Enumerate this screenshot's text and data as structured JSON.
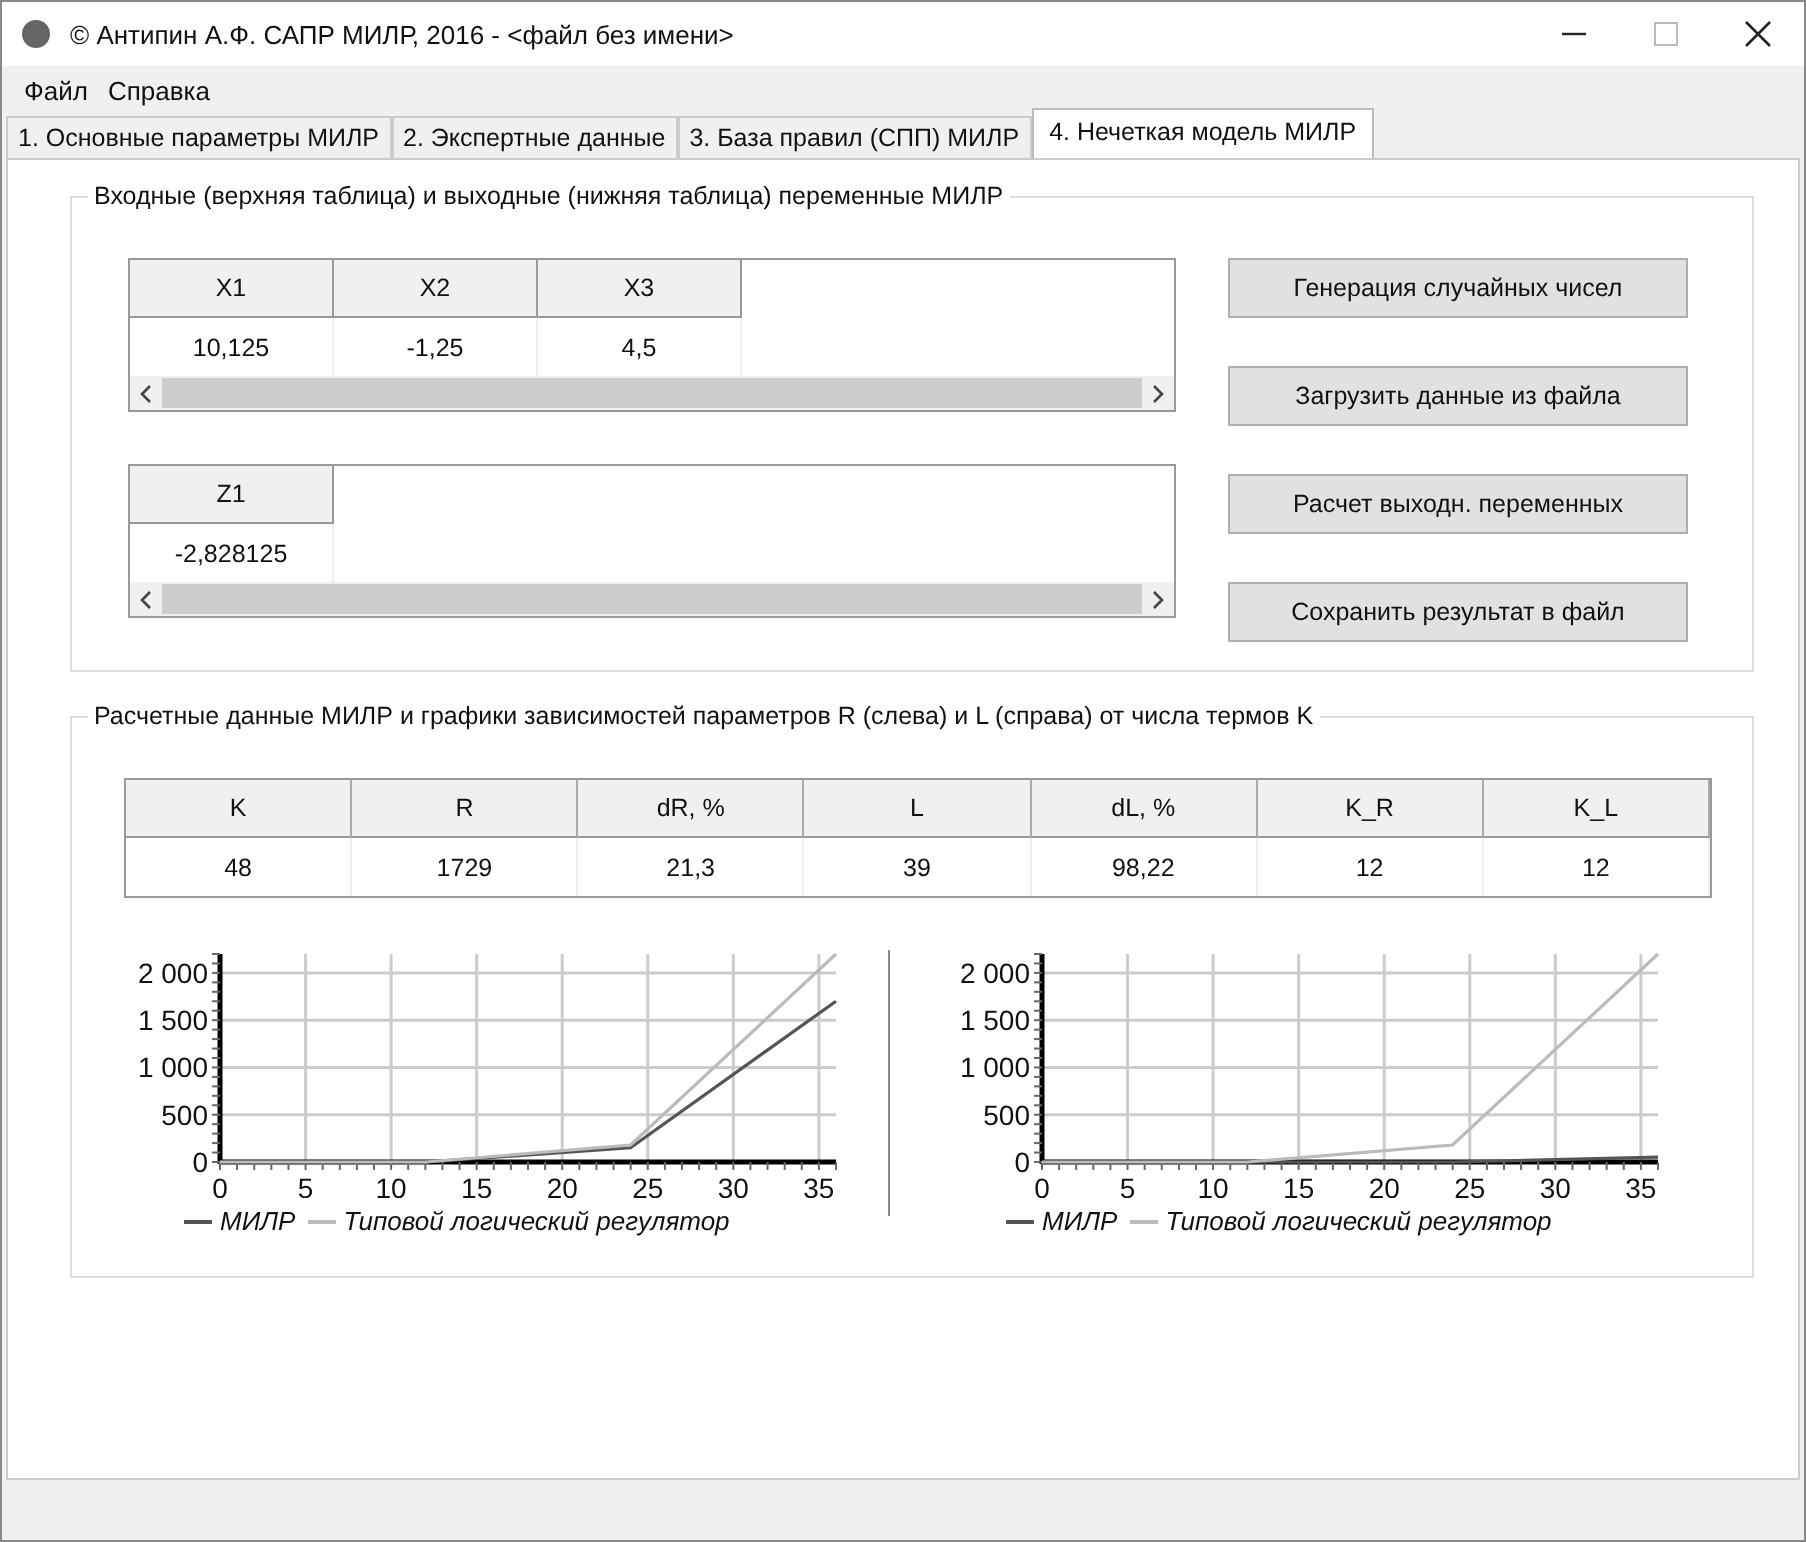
{
  "window": {
    "title": "© Антипин А.Ф. САПР МИЛР, 2016 - <файл без имени>"
  },
  "menu": [
    "Файл",
    "Справка"
  ],
  "tabs": [
    {
      "label": "1. Основные параметры МИЛР",
      "selected": false
    },
    {
      "label": "2. Экспертные данные",
      "selected": false
    },
    {
      "label": "3. База правил (СПП) МИЛР",
      "selected": false
    },
    {
      "label": "4. Нечеткая модель МИЛР",
      "selected": true
    }
  ],
  "variables_group": {
    "title": "Входные (верхняя таблица) и выходные (нижняя таблица) переменные МИЛР",
    "input_table": {
      "columns": [
        "X1",
        "X2",
        "X3"
      ],
      "rows": [
        [
          "10,125",
          "-1,25",
          "4,5"
        ]
      ]
    },
    "output_table": {
      "columns": [
        "Z1"
      ],
      "rows": [
        [
          "-2,828125"
        ]
      ]
    },
    "buttons": [
      "Генерация случайных чисел",
      "Загрузить данные из файла",
      "Расчет выходн. переменных",
      "Сохранить результат в файл"
    ]
  },
  "results_group": {
    "title": "Расчетные данные МИЛР и графики зависимостей параметров R (слева) и L (справа) от числа термов K",
    "table": {
      "columns": [
        "K",
        "R",
        "dR, %",
        "L",
        "dL, %",
        "K_R",
        "K_L"
      ],
      "rows": [
        [
          "48",
          "1729",
          "21,3",
          "39",
          "98,22",
          "12",
          "12"
        ]
      ]
    },
    "charts": [
      {
        "chart_data": {
          "type": "line",
          "x": [
            0,
            12,
            24,
            36
          ],
          "grid": true,
          "legend": true,
          "series": [
            {
              "name": "МИЛР",
              "color": "#555555",
              "values": [
                0,
                0,
                150,
                1700
              ]
            },
            {
              "name": "Типовой логический регулятор",
              "color": "#bbbbbb",
              "values": [
                0,
                0,
                180,
                2200
              ]
            }
          ],
          "xlim": [
            0,
            36
          ],
          "ylim": [
            0,
            2200
          ],
          "xticks": [
            0,
            5,
            10,
            15,
            20,
            25,
            30,
            35
          ],
          "yticks": [
            {
              "value": 0,
              "label": "0"
            },
            {
              "value": 500,
              "label": "500"
            },
            {
              "value": 1000,
              "label": "1 000"
            },
            {
              "value": 1500,
              "label": "1 500"
            },
            {
              "value": 2000,
              "label": "2 000"
            }
          ]
        }
      },
      {
        "chart_data": {
          "type": "line",
          "x": [
            0,
            12,
            24,
            36
          ],
          "grid": true,
          "legend": true,
          "series": [
            {
              "name": "МИЛР",
              "color": "#555555",
              "values": [
                0,
                0,
                0,
                50
              ]
            },
            {
              "name": "Типовой логический регулятор",
              "color": "#bbbbbb",
              "values": [
                0,
                0,
                180,
                2200
              ]
            }
          ],
          "xlim": [
            0,
            36
          ],
          "ylim": [
            0,
            2200
          ],
          "xticks": [
            0,
            5,
            10,
            15,
            20,
            25,
            30,
            35
          ],
          "yticks": [
            {
              "value": 0,
              "label": "0"
            },
            {
              "value": 500,
              "label": "500"
            },
            {
              "value": 1000,
              "label": "1 000"
            },
            {
              "value": 1500,
              "label": "1 500"
            },
            {
              "value": 2000,
              "label": "2 000"
            }
          ]
        }
      }
    ]
  }
}
